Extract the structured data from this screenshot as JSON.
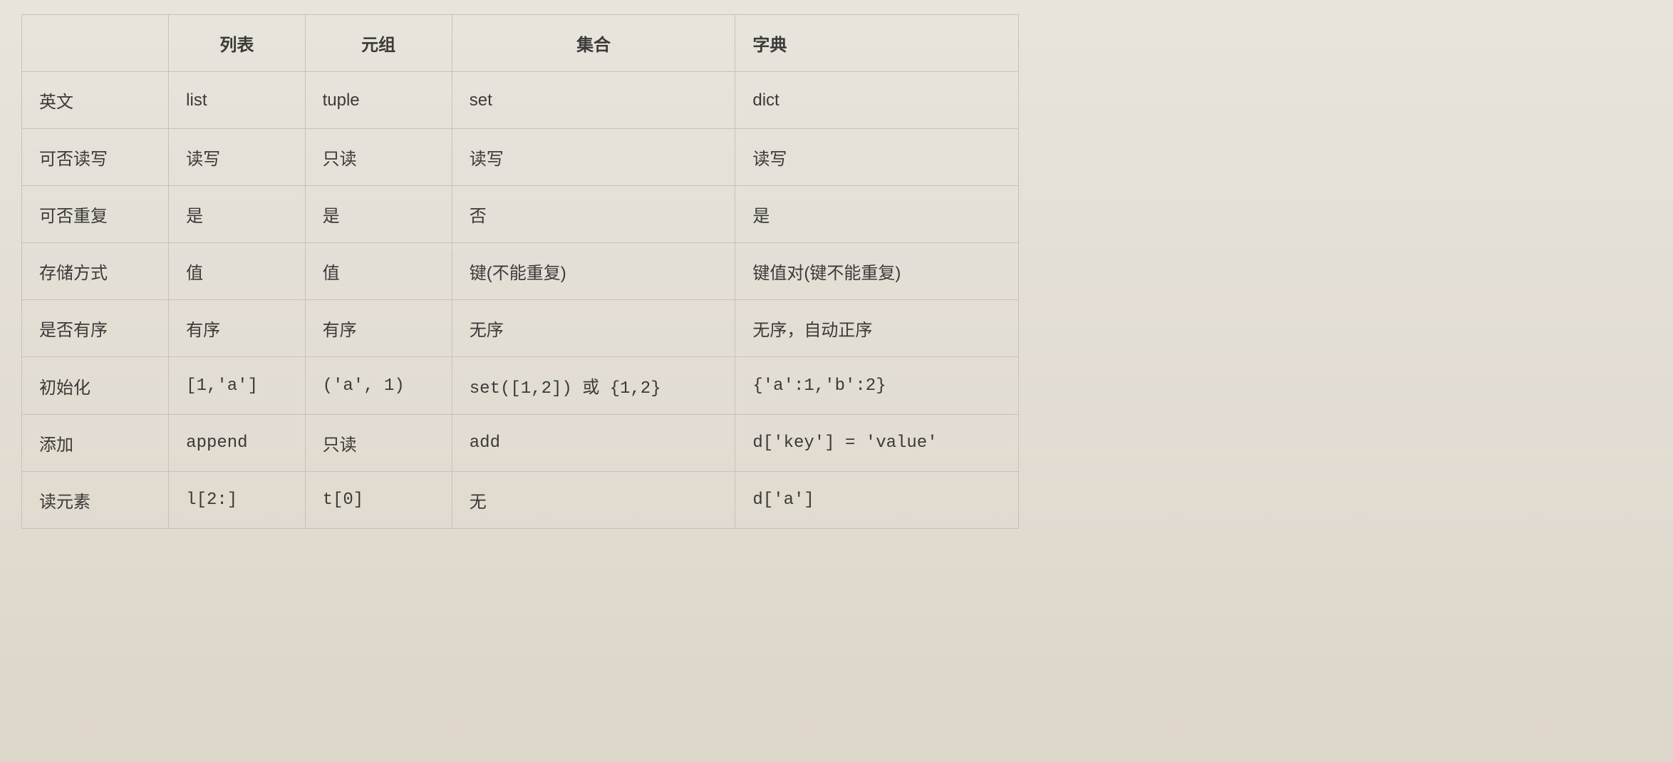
{
  "chart_data": {
    "type": "table",
    "title": "",
    "columns": [
      "",
      "列表",
      "元组",
      "集合",
      "字典"
    ],
    "rows": [
      {
        "label": "英文",
        "values": [
          "list",
          "tuple",
          "set",
          "dict"
        ]
      },
      {
        "label": "可否读写",
        "values": [
          "读写",
          "只读",
          "读写",
          "读写"
        ]
      },
      {
        "label": "可否重复",
        "values": [
          "是",
          "是",
          "否",
          "是"
        ]
      },
      {
        "label": "存储方式",
        "values": [
          "值",
          "值",
          "键(不能重复)",
          "键值对(键不能重复)"
        ]
      },
      {
        "label": "是否有序",
        "values": [
          "有序",
          "有序",
          "无序",
          "无序，自动正序"
        ]
      },
      {
        "label": "初始化",
        "values": [
          "[1,'a']",
          "('a', 1)",
          "set([1,2]) 或 {1,2}",
          "{'a':1,'b':2}"
        ]
      },
      {
        "label": "添加",
        "values": [
          "append",
          "只读",
          "add",
          "d['key'] = 'value'"
        ]
      },
      {
        "label": "读元素",
        "values": [
          "l[2:]",
          "t[0]",
          "无",
          "d['a']"
        ]
      }
    ]
  },
  "headers": {
    "blank": "",
    "col1": "列表",
    "col2": "元组",
    "col3": "集合",
    "col4": "字典"
  },
  "rows": {
    "r0": {
      "label": "英文",
      "c1": "list",
      "c2": "tuple",
      "c3": "set",
      "c4": "dict"
    },
    "r1": {
      "label": "可否读写",
      "c1": "读写",
      "c2": "只读",
      "c3": "读写",
      "c4": "读写"
    },
    "r2": {
      "label": "可否重复",
      "c1": "是",
      "c2": "是",
      "c3": "否",
      "c4": "是"
    },
    "r3": {
      "label": "存储方式",
      "c1": "值",
      "c2": "值",
      "c3": "键(不能重复)",
      "c4": "键值对(键不能重复)"
    },
    "r4": {
      "label": "是否有序",
      "c1": "有序",
      "c2": "有序",
      "c3": "无序",
      "c4": "无序，自动正序"
    },
    "r5": {
      "label": "初始化",
      "c1": "[1,'a']",
      "c2": "('a', 1)",
      "c3": "set([1,2]) 或 {1,2}",
      "c4": "{'a':1,'b':2}"
    },
    "r6": {
      "label": "添加",
      "c1": "append",
      "c2": "只读",
      "c3": "add",
      "c4": "d['key'] = 'value'"
    },
    "r7": {
      "label": "读元素",
      "c1": "l[2:]",
      "c2": "t[0]",
      "c3": "无",
      "c4": "d['a']"
    }
  }
}
